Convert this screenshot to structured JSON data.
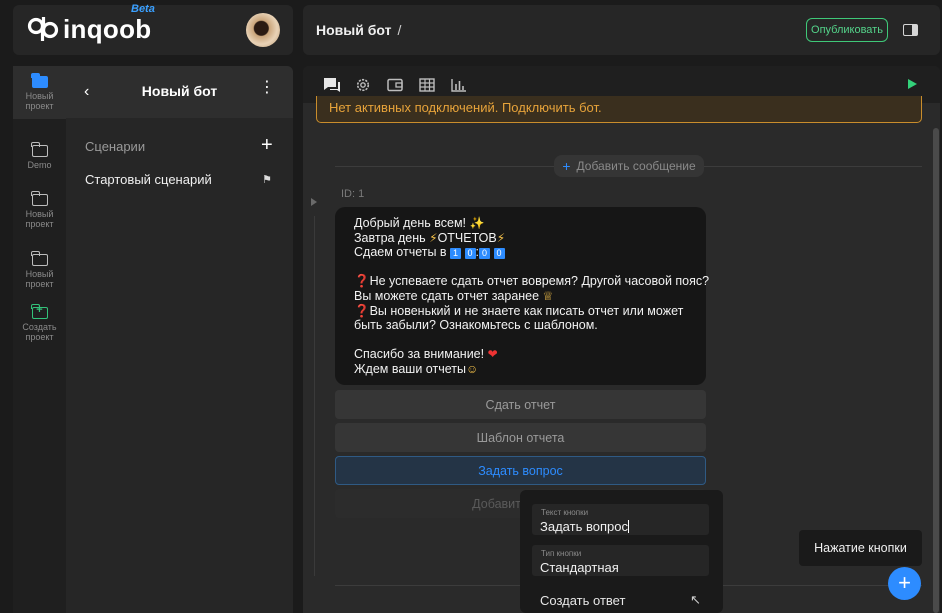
{
  "app": {
    "logo_text": "inqoob",
    "beta": "Beta"
  },
  "header": {
    "title": "Новый бот",
    "separator": "/",
    "publish_label": "Опубликовать"
  },
  "rail": {
    "items": [
      {
        "label": "Новый проект",
        "active": true
      },
      {
        "label": "Demo"
      },
      {
        "label": "Новый проект"
      },
      {
        "label": "Новый проект"
      },
      {
        "label": "Создать проект",
        "create": true
      }
    ]
  },
  "bot": {
    "name": "Новый бот",
    "scenarios_title": "Сценарии",
    "scenarios": [
      {
        "label": "Стартовый сценарий"
      }
    ]
  },
  "editor": {
    "warning": "Нет активных подключений. Подключить бот.",
    "add_message": "Добавить сообщение",
    "message_id": "ID: 1",
    "message": {
      "line1": "Добрый день всем!",
      "line2a": "Завтра день",
      "line2b": "ОТЧЕТОВ",
      "line3": "Сдаем отчеты в",
      "time_digits": [
        "1",
        "0",
        "0",
        "0"
      ],
      "line5": "❓Не успеваете сдать отчет вовремя? Другой часовой пояс?",
      "line6": "Вы можете сдать отчет заранее",
      "line7": "❓Вы новенький и не знаете как писать отчет или может",
      "line8": "быть забыли? Ознакомьтесь с шаблоном.",
      "line10": "Спасибо за внимание!",
      "line11": "Ждем ваши отчеты"
    },
    "buttons": [
      {
        "label": "Сдать отчет"
      },
      {
        "label": "Шаблон отчета"
      },
      {
        "label": "Задать вопрос",
        "active": true
      }
    ],
    "add_button": "Добавить кнопку"
  },
  "popup": {
    "text_label": "Текст кнопки",
    "text_value": "Задать вопрос",
    "type_label": "Тип кнопки",
    "type_value": "Стандартная",
    "create_answer": "Создать ответ"
  },
  "tooltip": "Нажатие кнопки",
  "colors": {
    "accent": "#2d8cff",
    "success": "#33d17a",
    "warning": "#e7a33a"
  }
}
